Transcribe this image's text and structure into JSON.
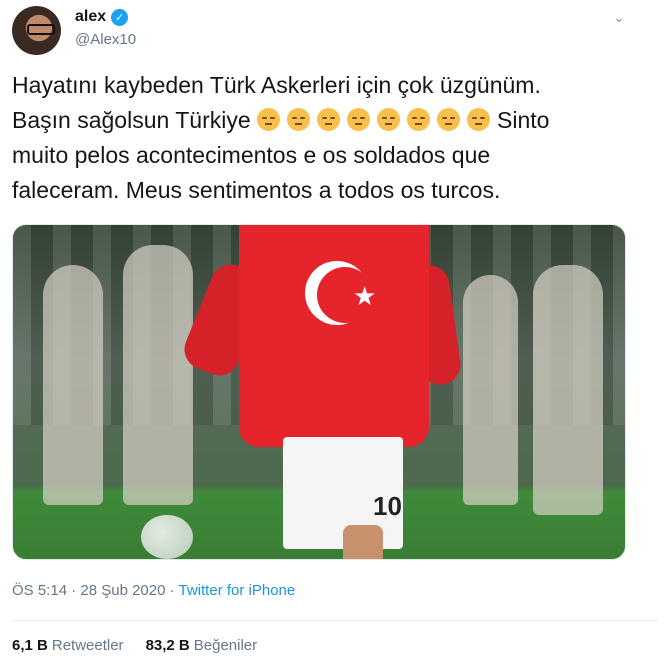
{
  "author": {
    "name": "alex",
    "handle": "@Alex10",
    "verified_glyph": "✓"
  },
  "tweet": {
    "line1": "Hayatını kaybeden Türk Askerleri için çok üzgünüm.",
    "line2_start": "Başın sağolsun Türkiye ",
    "emoji_name": "pensive-face-emoji",
    "emoji_count": 8,
    "line2_end": "Sinto",
    "line3": "muito pelos acontecimentos e os soldados que",
    "line4": "faleceram. Meus sentimentos a todos os turcos."
  },
  "media": {
    "jersey_number": "10"
  },
  "meta": {
    "timestamp": "ÖS 5:14 · 28 Şub 2020",
    "separator": " · ",
    "source": "Twitter for iPhone"
  },
  "stats": {
    "retweets_count": "6,1 B",
    "retweets_label": "Retweetler",
    "likes_count": "83,2 B",
    "likes_label": "Beğeniler"
  },
  "icons": {
    "caret": "chevron-down-icon",
    "verified": "verified-badge-icon"
  },
  "colors": {
    "accent": "#1da1f2",
    "link": "#1b95e0",
    "secondary_text": "#657786"
  }
}
